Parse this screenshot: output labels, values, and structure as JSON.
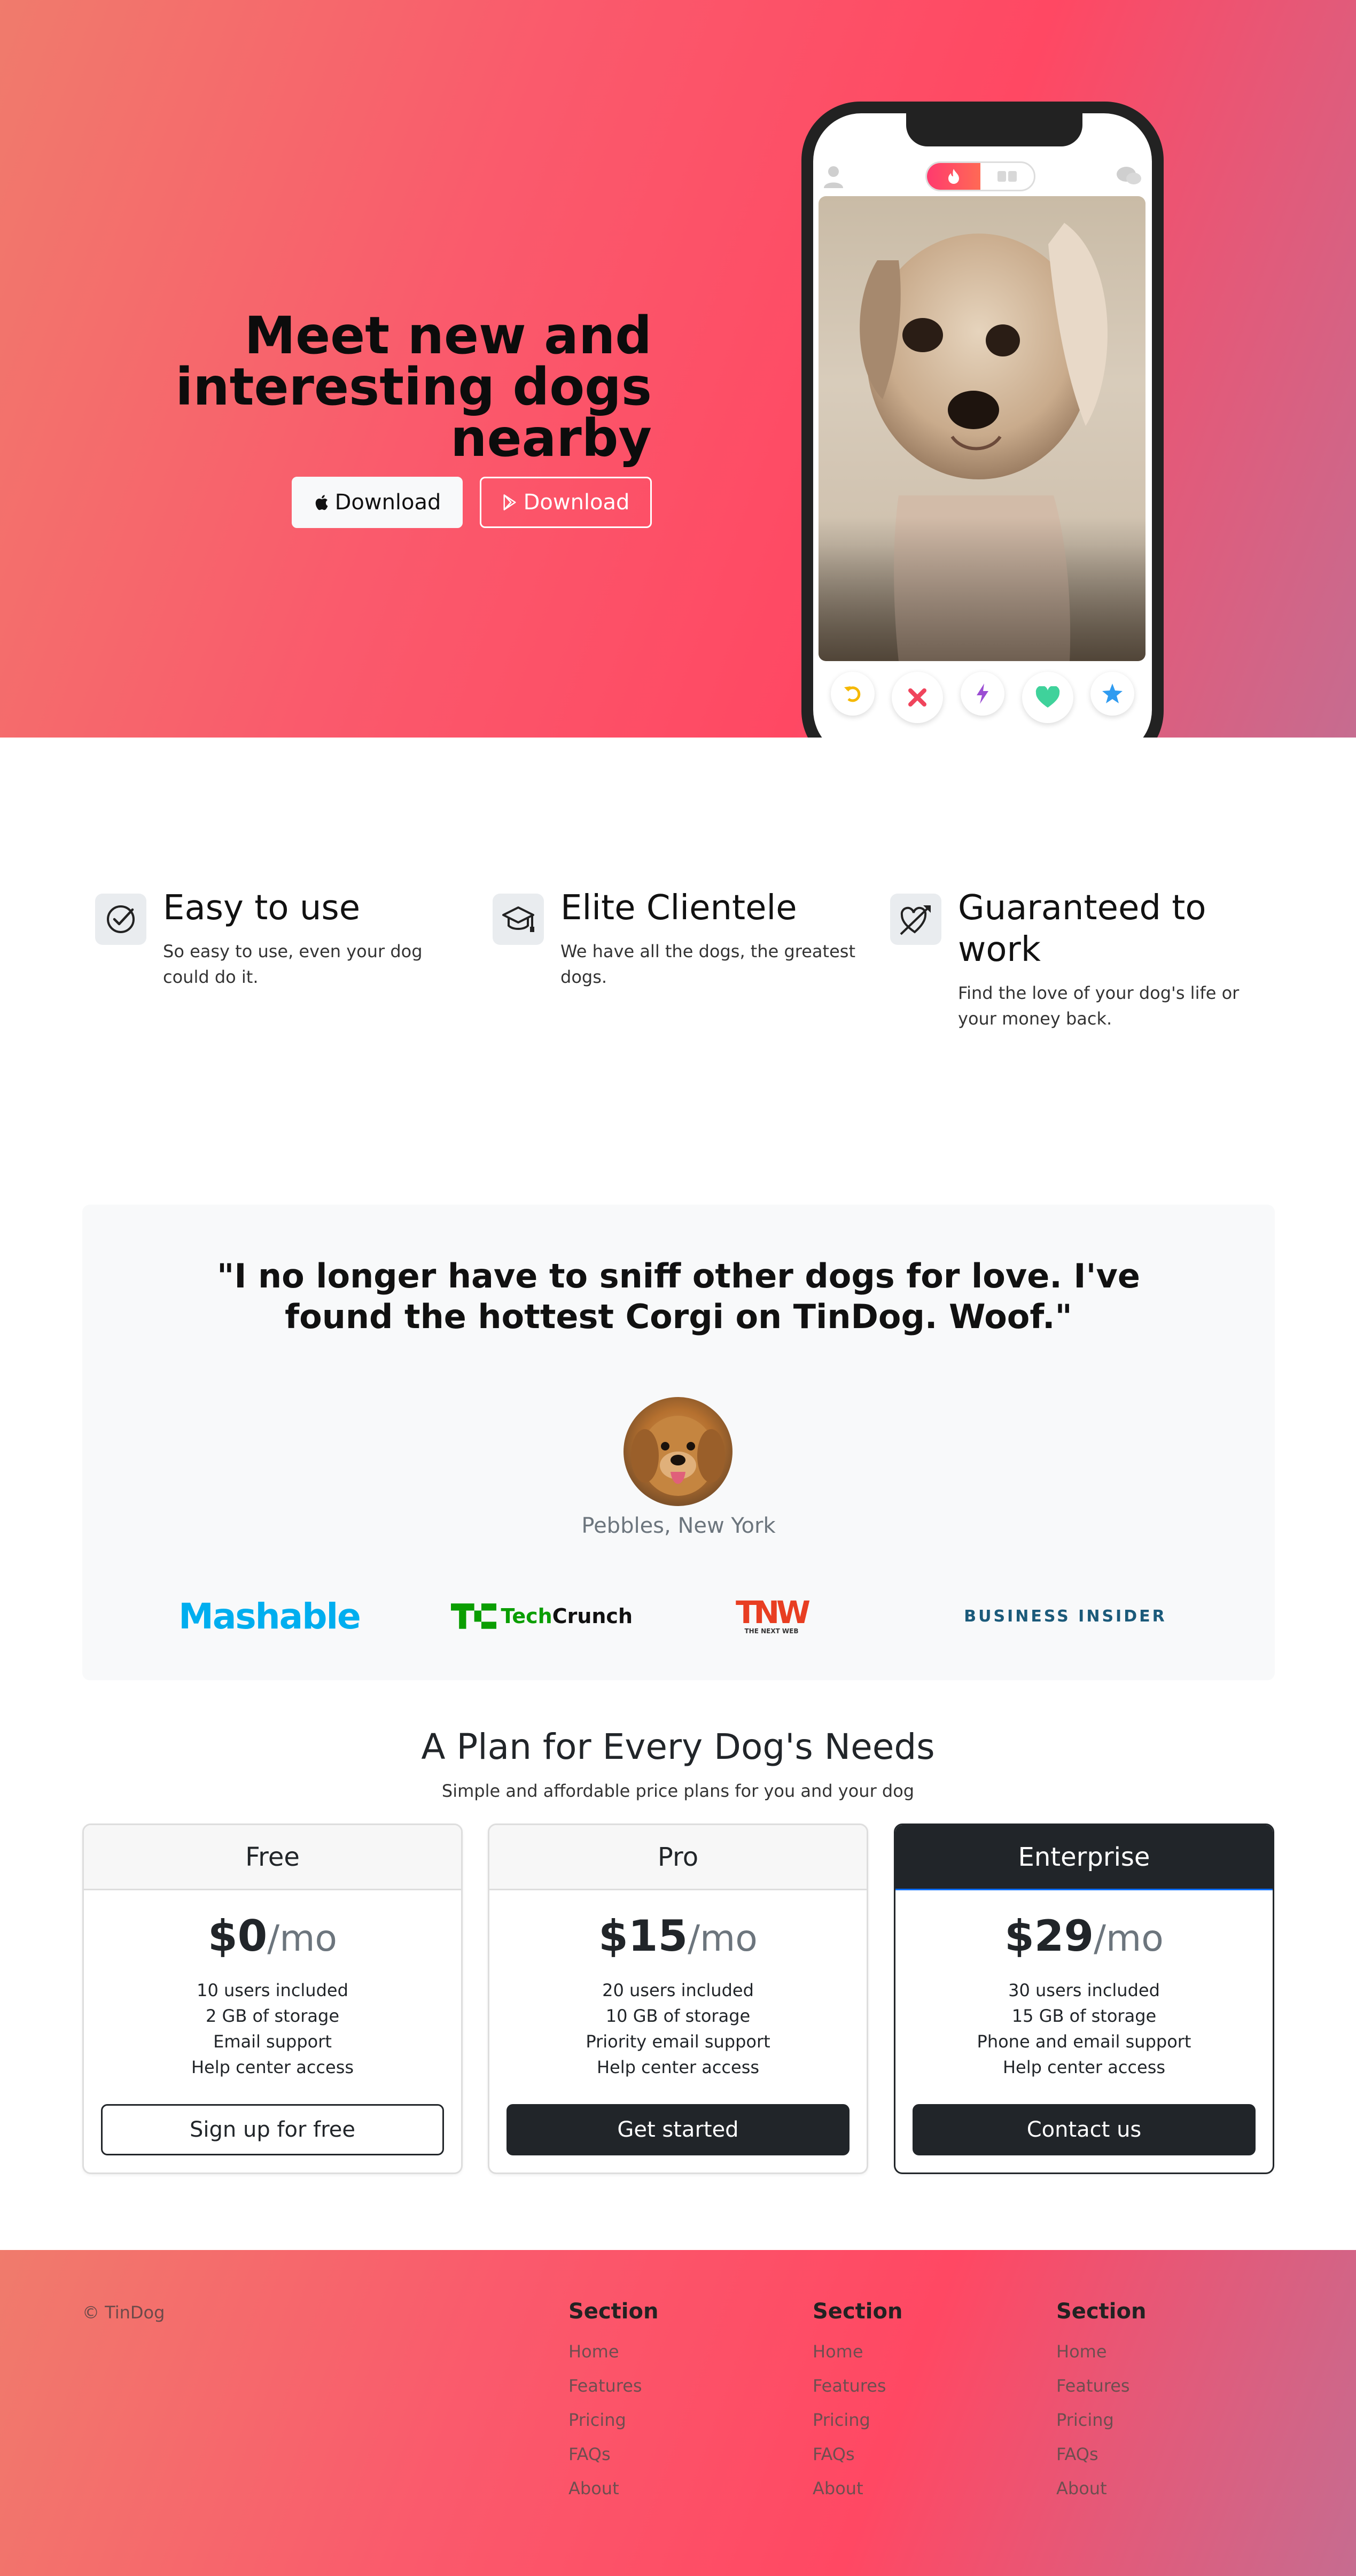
{
  "hero": {
    "title": "Meet new and interesting dogs nearby",
    "apple_button_label": "Download",
    "play_button_label": "Download"
  },
  "features": [
    {
      "title": "Easy to use",
      "description": "So easy to use, even your dog could do it.",
      "icon": "check-circle-icon"
    },
    {
      "title": "Elite Clientele",
      "description": "We have all the dogs, the greatest dogs.",
      "icon": "graduation-cap-icon"
    },
    {
      "title": "Guaranteed to work",
      "description": "Find the love of your dog's life or your money back.",
      "icon": "heart-arrow-icon"
    }
  ],
  "testimonial": {
    "quote": "\"I no longer have to sniff other dogs for love. I've found the hottest Corgi on TinDog. Woof.\"",
    "author": "Pebbles, New York",
    "press_logos": [
      "Mashable",
      "TechCrunch",
      "TNW",
      "BUSINESS INSIDER"
    ],
    "tnw_sub": "THE NEXT WEB"
  },
  "pricing": {
    "title": "A Plan for Every Dog's Needs",
    "subtitle": "Simple and affordable price plans for you and your dog",
    "plans": [
      {
        "name": "Free",
        "price": "$0",
        "period": "/mo",
        "features": [
          "10 users included",
          "2 GB of storage",
          "Email support",
          "Help center access"
        ],
        "button": "Sign up for free"
      },
      {
        "name": "Pro",
        "price": "$15",
        "period": "/mo",
        "features": [
          "20 users included",
          "10 GB of storage",
          "Priority email support",
          "Help center access"
        ],
        "button": "Get started"
      },
      {
        "name": "Enterprise",
        "price": "$29",
        "period": "/mo",
        "features": [
          "30 users included",
          "15 GB of storage",
          "Phone and email support",
          "Help center access"
        ],
        "button": "Contact us"
      }
    ]
  },
  "footer": {
    "copyright": "© TinDog",
    "columns": [
      {
        "heading": "Section",
        "links": [
          "Home",
          "Features",
          "Pricing",
          "FAQs",
          "About"
        ]
      },
      {
        "heading": "Section",
        "links": [
          "Home",
          "Features",
          "Pricing",
          "FAQs",
          "About"
        ]
      },
      {
        "heading": "Section",
        "links": [
          "Home",
          "Features",
          "Pricing",
          "FAQs",
          "About"
        ]
      }
    ]
  },
  "colors": {
    "brand_gradient_start": "#f07b6c",
    "brand_gradient_mid": "#ff4863",
    "brand_gradient_end": "#c66c90",
    "dark": "#212529",
    "mashable": "#00aeef",
    "techcrunch": "#0a9e01",
    "tnw": "#e83e22",
    "business_insider": "#1b5a7a"
  }
}
